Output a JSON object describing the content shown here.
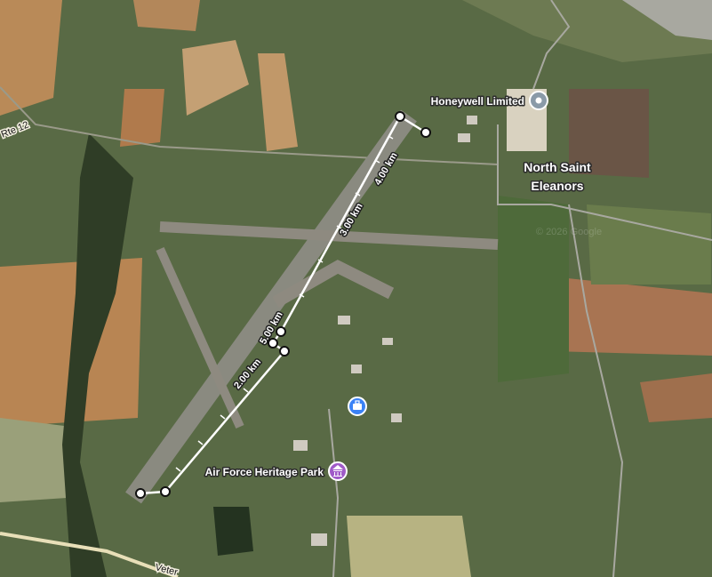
{
  "map": {
    "pois": [
      {
        "name": "Honeywell Limited",
        "icon": "pin-circle-icon",
        "color": "#8a9aa8"
      },
      {
        "name": "North Saint Eleanors",
        "icon": "",
        "color": ""
      },
      {
        "name": "Air Force Heritage Park",
        "icon": "museum-icon",
        "color": "#a05bc8"
      },
      {
        "name": "",
        "icon": "briefcase-icon",
        "color": "#3b82f6"
      }
    ],
    "place_label_line1": "North Saint",
    "place_label_line2": "Eleanors",
    "roads": [
      "Rte 12",
      "Veter"
    ],
    "measure": {
      "ticks": [
        "2.00 km",
        "3.00 km",
        "4.00 km",
        "5.00 km"
      ],
      "line_color": "#ffffff"
    },
    "watermark": "© 2026 Google"
  }
}
